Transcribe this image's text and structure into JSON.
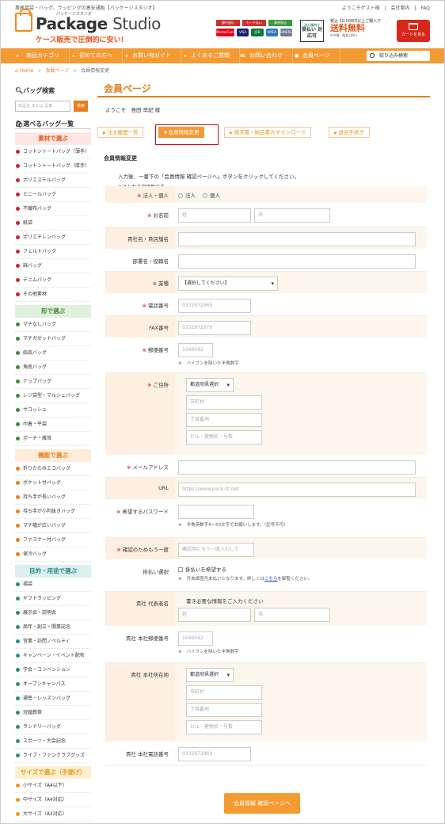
{
  "header": {
    "tagline": "業務用袋・バッグ、ラッピングの激安通販【パッケージスタジオ】",
    "links": [
      "ようこそゲスト様",
      "会社案内",
      "FAQ"
    ],
    "logo_kana": "パッケージスタジオ",
    "logo_word": "Package",
    "logo_word_light": "Studio",
    "logo_slogan": "ケース販売で圧倒的に安い!",
    "pay_badges": [
      "銀行振込",
      "カード払い",
      "郵便振込"
    ],
    "cards": [
      "MasterCard",
      "VISA",
      "JCB",
      "AMEX",
      "DINERS"
    ],
    "hebox_top": "法人様向け",
    "hebox_main": "掛払い 対応可",
    "freeship_top": "税込",
    "freeship_amount": "10,000円以上ご購入で",
    "freeship_main": "送料無料",
    "freeship_sub": "※沖縄・離島は除く",
    "cart_label": "カートを見る"
  },
  "nav": {
    "items": [
      "商品カテゴリ",
      "初めての方へ",
      "お買い物ガイド",
      "よくあるご質問",
      "お問い合わせ",
      "会員ページ"
    ],
    "search_label": "絞り込み検索"
  },
  "breadcrumb": {
    "home": "Home",
    "parent": "会員ページ",
    "current": "会員情報変更"
  },
  "sidebar": {
    "search_title": "バッグ検索",
    "search_placeholder": "商品名 または 品番",
    "search_button": "検索",
    "list_title": "選べるバッグ一覧",
    "groups": [
      {
        "title": "素材で選ぶ",
        "style": "red",
        "items": [
          "コットントートバッグ（薄手）",
          "コットントートバッグ（厚手）",
          "ポリエステルバッグ",
          "ビニールバッグ",
          "不織布バッグ",
          "紙袋",
          "ポリエチレンバッグ",
          "フェルトバッグ",
          "麻バッグ",
          "デニムバッグ",
          "その他素材"
        ]
      },
      {
        "title": "形で選ぶ",
        "style": "green",
        "items": [
          "マチなしバッグ",
          "マチガゼットバッグ",
          "船底バッグ",
          "角底バッグ",
          "ナップバッグ",
          "レジ袋型・マルシェバッグ",
          "サコッシュ",
          "巾着・平袋",
          "ポーチ・雑貨"
        ]
      },
      {
        "title": "機能で選ぶ",
        "style": "orange",
        "items": [
          "折りたたみエコバッグ",
          "ポケット付バッグ",
          "持ち手が長いバッグ",
          "持ち手が小判抜きバッグ",
          "マチ幅が広いバッグ",
          "ファスナー付バッグ",
          "保冷バッグ"
        ]
      },
      {
        "title": "目的・用途で選ぶ",
        "style": "teal",
        "items": [
          "福袋",
          "ギフトラッピング",
          "展示会・説明会",
          "周年・創立・開業記念",
          "営業・訪問ノベルティ",
          "キャンペーン・イベント配布",
          "学会・コンベンション",
          "オープンキャンパス",
          "通塾・レッスンバッグ",
          "冠婚葬祭",
          "ランドリーバッグ",
          "スポーツ・大会記念",
          "ライブ・ファンクラブグッズ"
        ]
      },
      {
        "title": "サイズで選ぶ（手提げ）",
        "style": "yellow",
        "items": [
          "小サイズ（A4以下）",
          "中サイズ（A4対応）",
          "大サイズ（A3対応）"
        ]
      }
    ]
  },
  "main": {
    "title": "会員ページ",
    "welcome": "ようこそ　島田 早紀 様",
    "tabs": [
      "注文履歴一覧",
      "会員情報変更",
      "請求書・納品書のダウンロード",
      "退会手続き"
    ],
    "section_label": "会員情報変更",
    "intro": "入力後、一番下の「会員情報 確認ページへ」ボタンをクリックしてください。",
    "required_note": "※は入力必須項目です。",
    "form": {
      "type_label": "法人・個人",
      "type_opt1": "法人",
      "type_opt2": "個人",
      "name_label": "お名前",
      "name_ph1": "姓",
      "name_ph2": "名",
      "company_label": "貴社名・貴店舗名",
      "dept_label": "部署名・役職名",
      "industry_label": "業種",
      "industry_value": "【選択してください】",
      "phone_label": "電話番号",
      "phone_value": "0332972969",
      "fax_label": "FAX番号",
      "fax_value": "0332972970",
      "zip_label": "郵便番号",
      "zip_value": "1040042",
      "zip_note": "ハイフンを除いた半角数字",
      "addr_label": "ご住所",
      "addr_pref": "都道府県選択",
      "addr_city": "市町村",
      "addr_street": "丁目番地",
      "addr_bldg": "ビル・建物名・号数",
      "email_label": "メールアドレス",
      "url_label": "URL",
      "url_ph": "https://www.pack-st.net",
      "pw_label": "希望するパスワード",
      "pw_note": "半角英数字4〜50文字でお願いします。（記号不可）",
      "pw2_label": "確認のためもう一度",
      "pw2_ph": "確認用にもう一度入力して",
      "kake_label": "掛払い選択",
      "kake_check": "掛払いを希望する",
      "kake_note": "月末締翌月末払いとなります。詳しくは",
      "kake_link": "こちら",
      "kake_note2": "を御覧ください。",
      "rep_label": "貴社 代表者名",
      "rep_note": "書き必要な情報をご入力ください",
      "rep_ph1": "姓",
      "rep_ph2": "名",
      "hq_zip_label": "貴社 本社郵便番号",
      "hq_zip_value": "1040042",
      "hq_zip_note": "ハイフンを除いた半角数字",
      "hq_addr_label": "貴社 本社所在地",
      "hq_pref": "都道府県選択",
      "hq_city": "市町村",
      "hq_street": "丁目番地",
      "hq_bldg": "ビル・建物名・号数",
      "hq_phone_label": "貴社 本社電話番号",
      "hq_phone_value": "0332972969"
    },
    "submit_label": "会員情報 確認ページへ"
  }
}
